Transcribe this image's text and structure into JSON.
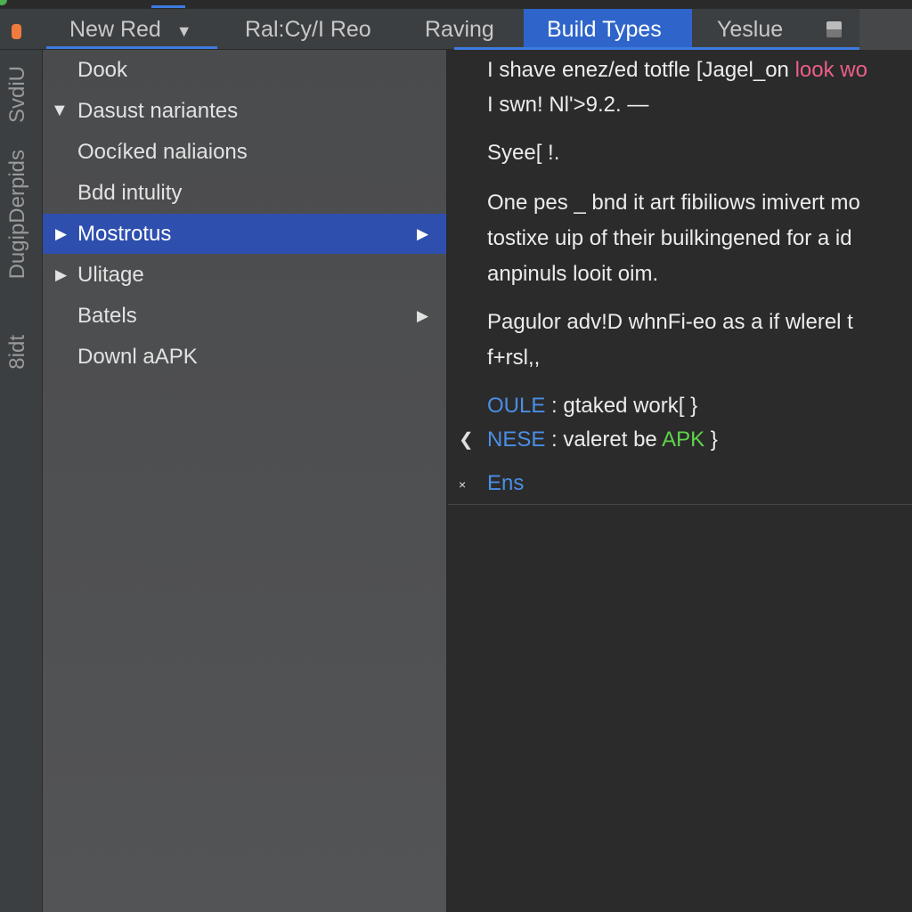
{
  "tabs": [
    {
      "label": "New Red",
      "dropdown": true
    },
    {
      "label": "Ral:Cy/I Reo"
    },
    {
      "label": "Raving"
    },
    {
      "label": "Build Types",
      "active": true
    },
    {
      "label": "Yeslue"
    }
  ],
  "side_labels": [
    "SvdiU",
    "DugipDerpids",
    "8idt"
  ],
  "tree": [
    {
      "label": "Dook"
    },
    {
      "label": "Dasust nariantes",
      "expanded": true
    },
    {
      "label": "Oocíked naliaions"
    },
    {
      "label": "Bdd intulity"
    },
    {
      "label": "Mostrotus",
      "selected": true
    },
    {
      "label": "Ulitage"
    },
    {
      "label": "Batels"
    },
    {
      "label": "Downl aAPK"
    }
  ],
  "content": {
    "l1a": "I shave enez/ed totfle [Jagel_on ",
    "l1b": "look wo",
    "l2": "I swn! Nl'>9.2. —",
    "l3": "Syee[ !.",
    "l4": "One pes _ bnd it art fibiliows imivert mo",
    "l5": "tostixe uip of their builkingened for a id",
    "l6": "anpinuls looit oim.",
    "l7": "Pagulor adv!D whnFi-eo as a if wlerel t",
    "l8": "f+rsl,,",
    "l9k": "OULE",
    "l9": " : gtaked work[ }",
    "l10k": "NESE",
    "l10": " : valeret be ",
    "l10g": "APK",
    "l10e": " }",
    "l11": "Ens"
  },
  "colors": {
    "accent": "#2f65ca",
    "selected_row": "#2e4fae",
    "keyword": "#4a8ee6",
    "string_pink": "#ec5f87",
    "green": "#5fd44b"
  }
}
